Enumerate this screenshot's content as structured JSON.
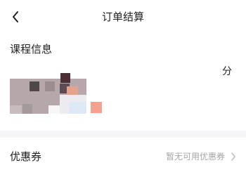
{
  "header": {
    "title": "订单结算",
    "back_icon": "chevron-left-icon"
  },
  "course": {
    "section_title": "课程信息",
    "side_text": "分"
  },
  "coupon": {
    "label": "优惠券",
    "status": "暂无可用优惠券",
    "chevron_icon": "chevron-right-icon"
  },
  "colors": {
    "background": "#ffffff",
    "separator": "#f5f5f7",
    "text_primary": "#222222",
    "text_secondary": "#a6a6a6",
    "accent": "#f6a18f"
  }
}
